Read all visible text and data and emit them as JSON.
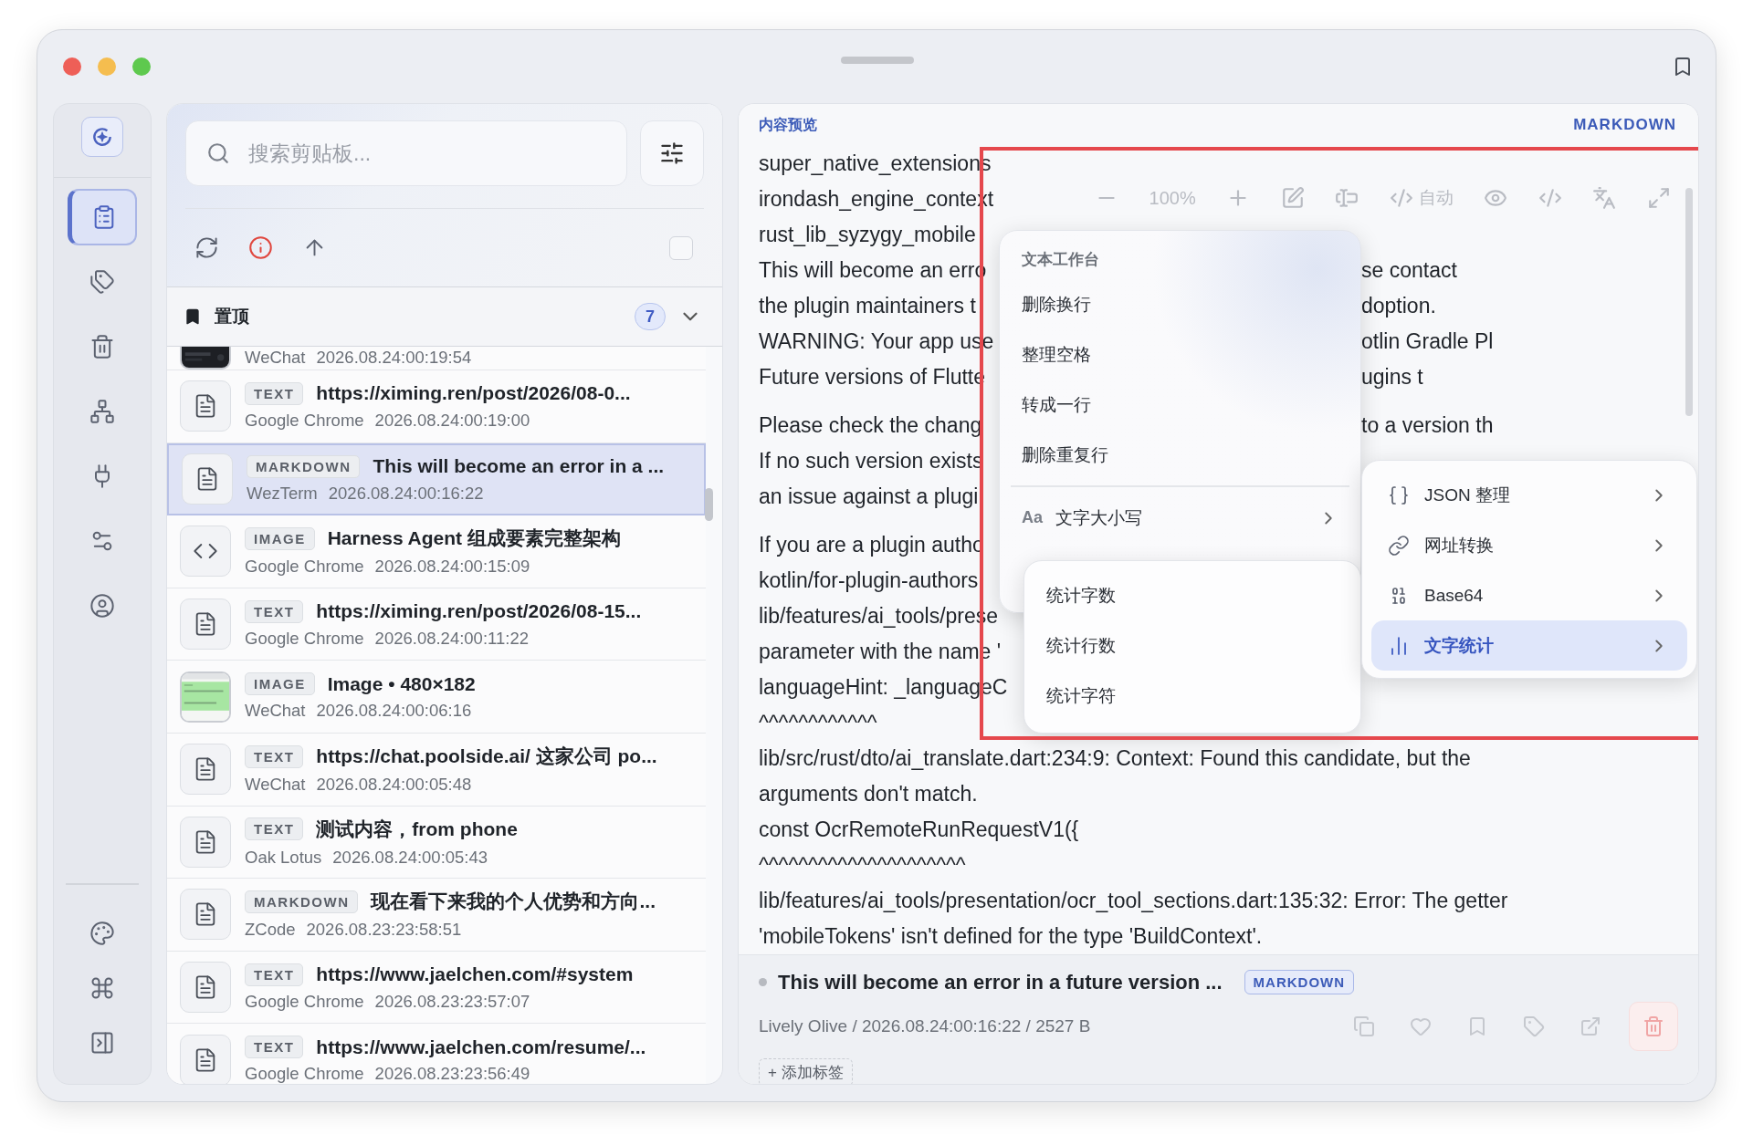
{
  "sidebar": {
    "items": [
      {
        "selected": true
      },
      {
        "selected": false
      },
      {
        "selected": false
      },
      {
        "selected": false
      },
      {
        "selected": false
      },
      {
        "selected": false
      },
      {
        "selected": false
      }
    ]
  },
  "search": {
    "placeholder": "搜索剪贴板..."
  },
  "select_all": {
    "checked": false
  },
  "pinned": {
    "label": "置顶",
    "count": "7",
    "expanded": true
  },
  "clips": [
    {
      "kind": "partial",
      "source": "WeChat",
      "time": "2026.08.24:00:19:54",
      "selected": false
    },
    {
      "kind": "document",
      "type_label": "TEXT",
      "title": "https://ximing.ren/post/2026/08-0...",
      "source": "Google Chrome",
      "time": "2026.08.24:00:19:00",
      "selected": false
    },
    {
      "kind": "document",
      "type_label": "MARKDOWN",
      "title": "This will become an error in a ...",
      "source": "WezTerm",
      "time": "2026.08.24:00:16:22",
      "selected": true
    },
    {
      "kind": "code",
      "type_label": "IMAGE",
      "title": "Harness Agent 组成要素完整架构",
      "source": "Google Chrome",
      "time": "2026.08.24:00:15:09",
      "selected": false
    },
    {
      "kind": "document",
      "type_label": "TEXT",
      "title": "https://ximing.ren/post/2026/08-15...",
      "source": "Google Chrome",
      "time": "2026.08.24:00:11:22",
      "selected": false
    },
    {
      "kind": "thumbnail",
      "type_label": "IMAGE",
      "title": "Image • 480×182",
      "source": "WeChat",
      "time": "2026.08.24:00:06:16",
      "selected": false
    },
    {
      "kind": "document",
      "type_label": "TEXT",
      "title": "https://chat.poolside.ai/ 这家公司 po...",
      "source": "WeChat",
      "time": "2026.08.24:00:05:48",
      "selected": false
    },
    {
      "kind": "document",
      "type_label": "TEXT",
      "title": "测试内容，from phone",
      "source": "Oak Lotus",
      "time": "2026.08.24:00:05:43",
      "selected": false
    },
    {
      "kind": "document",
      "type_label": "MARKDOWN",
      "title": "现在看下来我的个人优势和方向...",
      "source": "ZCode",
      "time": "2026.08.23:23:58:51",
      "selected": false
    },
    {
      "kind": "document",
      "type_label": "TEXT",
      "title": "https://www.jaelchen.com/#system",
      "source": "Google Chrome",
      "time": "2026.08.23:23:57:07",
      "selected": false
    },
    {
      "kind": "document",
      "type_label": "TEXT",
      "title": "https://www.jaelchen.com/resume/...",
      "source": "Google Chrome",
      "time": "2026.08.23:23:56:49",
      "selected": false
    }
  ],
  "preview": {
    "header": "内容预览",
    "format": "MARKDOWN",
    "toolbar": {
      "zoom": "100%",
      "mode": "自动"
    },
    "lines": [
      {
        "left": "super_native_extensions"
      },
      {
        "left": "irondash_engine_context"
      },
      {
        "left": "rust_lib_syzygy_mobile"
      },
      {
        "left": "This will become an erro",
        "right": "se contact"
      },
      {
        "left": "the plugin maintainers t",
        "right": "doption."
      },
      {
        "left": "WARNING: Your app use",
        "right": "otlin Gradle Pl"
      },
      {
        "left": "Future versions of Flutte",
        "right": "ugins t"
      },
      {
        "left": "Please check the chang",
        "right": "to a version th",
        "paragraph_start": true
      },
      {
        "left": "If no such version exists"
      },
      {
        "left": "an issue against a plugi"
      },
      {
        "left": "If you are a plugin autho",
        "paragraph_start": true
      },
      {
        "left": "kotlin/for-plugin-authors"
      },
      {
        "left": "lib/features/ai_tools/prese"
      },
      {
        "left": "parameter with the name '"
      },
      {
        "left": "languageHint: _languageC"
      },
      {
        "left": "^^^^^^^^^^^^"
      },
      {
        "left": "lib/src/rust/dto/ai_translate.dart:234:9: Context: Found this candidate, but the"
      },
      {
        "left": "arguments don't match."
      },
      {
        "left": "const OcrRemoteRunRequestV1({"
      },
      {
        "left": "^^^^^^^^^^^^^^^^^^^^^"
      },
      {
        "left": "lib/features/ai_tools/presentation/ocr_tool_sections.dart:135:32: Error: The getter"
      },
      {
        "left": "'mobileTokens' isn't defined for the type 'BuildContext'."
      }
    ],
    "footer": {
      "title": "This will become an error in a future version ...",
      "badge": "MARKDOWN",
      "meta": "Lively Olive / 2026.08.24:00:16:22 / 2527 B",
      "add_tag": "+ 添加标签"
    }
  },
  "context_menu": {
    "title": "文本工作台",
    "items": [
      "删除换行",
      "整理空格",
      "转成一行",
      "删除重复行"
    ],
    "case_item": {
      "prefix": "Aa",
      "label": "文字大小写"
    }
  },
  "submenu": {
    "items": [
      {
        "label": "JSON 整理",
        "selected": false
      },
      {
        "label": "网址转换",
        "selected": false
      },
      {
        "label": "Base64",
        "selected": false
      },
      {
        "label": "文字统计",
        "selected": true
      }
    ]
  },
  "stats_menu": {
    "items": [
      "统计字数",
      "统计行数",
      "统计字符"
    ]
  }
}
